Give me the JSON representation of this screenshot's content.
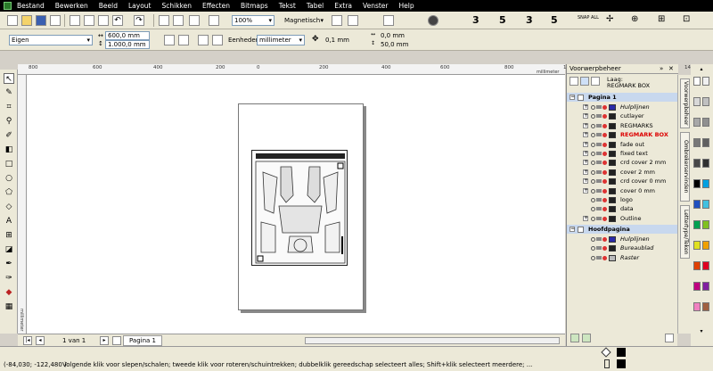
{
  "menu": [
    "Bestand",
    "Bewerken",
    "Beeld",
    "Layout",
    "Schikken",
    "Effecten",
    "Bitmaps",
    "Tekst",
    "Tabel",
    "Extra",
    "Venster",
    "Help"
  ],
  "toolbar1": {
    "zoom_value": "100%",
    "snap_label": "Magnetisch",
    "snap_all_label": "SNAP ALL"
  },
  "toolbar2": {
    "page_size": "Eigen",
    "width": "600,0 mm",
    "height": "1.000,0 mm",
    "units_label": "Eenheden:",
    "units_value": "millimeter",
    "nudge": "0,1 mm",
    "dup_x": "0,0 mm",
    "dup_y": "50,0 mm"
  },
  "ruler": {
    "h_ticks": [
      "800",
      "600",
      "400",
      "200",
      "0",
      "200",
      "400",
      "600",
      "800",
      "1000",
      "1200",
      "1400"
    ],
    "h_unit": "millimeter",
    "v_unit": "millimeter"
  },
  "artwork": {
    "label": "REGMARK BOX"
  },
  "pages": {
    "counter": "1 van 1",
    "tab": "Pagina 1"
  },
  "status": {
    "coords": "(-84,030; -122,480 )",
    "hint": "Volgende klik voor slepen/schalen; tweede klik voor roteren/schuintrekken; dubbelklik gereedschap selecteert alles; Shift+klik selecteert meerdere; ..."
  },
  "docker": {
    "title": "Voorwerpbeheer",
    "layer_label": "Laag:",
    "layer_value": "REGMARK BOX",
    "page1": "Pagina 1",
    "layers": [
      {
        "name": "Hulplijnen",
        "color": "#2a2aa8",
        "style": "italic"
      },
      {
        "name": "cutlayer",
        "color": "#222222",
        "style": "normal"
      },
      {
        "name": "REGMARKS",
        "color": "#222222",
        "style": "normal"
      },
      {
        "name": "REGMARK BOX",
        "color": "#222222",
        "style": "active"
      },
      {
        "name": "fade out",
        "color": "#222222",
        "style": "normal"
      },
      {
        "name": "fixed text",
        "color": "#222222",
        "style": "normal"
      },
      {
        "name": "crd cover 2 mm",
        "color": "#222222",
        "style": "normal"
      },
      {
        "name": "cover 2 mm",
        "color": "#222222",
        "style": "normal"
      },
      {
        "name": "crd cover 0 mm",
        "color": "#222222",
        "style": "normal"
      },
      {
        "name": "cover 0 mm",
        "color": "#222222",
        "style": "normal"
      },
      {
        "name": "logo",
        "color": "#222222",
        "style": "normal"
      },
      {
        "name": "data",
        "color": "#222222",
        "style": "normal"
      },
      {
        "name": "Outline",
        "color": "#222222",
        "style": "normal"
      }
    ],
    "master": "Hoofdpagina",
    "master_layers": [
      {
        "name": "Hulplijnen",
        "color": "#2a2aa8"
      },
      {
        "name": "Bureaublad",
        "color": "#222222"
      },
      {
        "name": "Raster",
        "color": "#bbbbbb"
      }
    ]
  },
  "side_tabs": [
    "Voorwerpbeheer",
    "Ombrekerservinden",
    "Lettertype/Teken"
  ],
  "palette_colors": [
    "#ffffff",
    "#f0f0f0",
    "#d8d8d8",
    "#c0c0c0",
    "#a8a8a8",
    "#909090",
    "#787878",
    "#606060",
    "#484848",
    "#303030",
    "#000000",
    "#00a0e0",
    "#2050c0",
    "#40c0e0",
    "#00a050",
    "#80c020",
    "#e0e020",
    "#f0a000",
    "#e04000",
    "#e00020",
    "#c00080",
    "#8020a0",
    "#f080c0",
    "#a06040"
  ]
}
